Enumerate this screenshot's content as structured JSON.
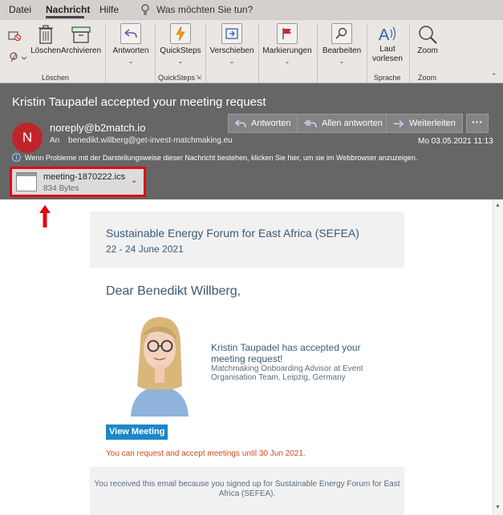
{
  "ribbon_tabs": {
    "file": "Datei",
    "message": "Nachricht",
    "help": "Hilfe",
    "tell_me": "Was möchten Sie tun?"
  },
  "ribbon": {
    "delete_group": {
      "delete": "Löschen",
      "archive": "Archivieren",
      "label": "Löschen"
    },
    "respond": {
      "label": "Antworten"
    },
    "quicksteps": {
      "button": "QuickSteps",
      "label": "QuickSteps"
    },
    "move": {
      "label": "Verschieben"
    },
    "tags": {
      "label": "Markierungen"
    },
    "edit": {
      "label": "Bearbeiten"
    },
    "speech": {
      "read_aloud_1": "Laut",
      "read_aloud_2": "vorlesen",
      "label": "Sprache"
    },
    "zoom": {
      "button": "Zoom",
      "label": "Zoom"
    }
  },
  "header": {
    "subject": "Kristin Taupadel accepted your meeting request",
    "avatar_initial": "N",
    "sender": "noreply@b2match.io",
    "to_label": "An",
    "to_address": "benedikt.willberg@get-invest-matchmaking.eu",
    "reply": "Antworten",
    "reply_all": "Allen antworten",
    "forward": "Weiterleiten",
    "more": "···",
    "datetime": "Mo 03.05.2021 11:13",
    "info": "Wenn Probleme mit der Darstellungsweise dieser Nachricht bestehen, klicken Sie hier, um sie im Webbrowser anzuzeigen.",
    "attachment_name": "meeting-1870222.ics",
    "attachment_size": "834 Bytes"
  },
  "email": {
    "event_title": "Sustainable Energy Forum for East Africa (SEFEA)",
    "event_date": "22 - 24 June 2021",
    "greeting": "Dear Benedikt Willberg,",
    "accepted": "Kristin Taupadel has accepted your meeting request!",
    "role": "Matchmaking Onboarding Advisor at Event Organisation Team, Leipzig, Germany",
    "view_button": "View Meeting",
    "deadline": "You can request and accept meetings until 30 Jun 2021.",
    "footer": "You received this email because you signed up for Sustainable Energy Forum for East Africa (SEFEA)."
  },
  "colors": {
    "header_bg": "#666666",
    "avatar": "#c0242b",
    "highlight": "#e30613",
    "button": "#1a88c9",
    "deadline": "#d44a1c"
  }
}
